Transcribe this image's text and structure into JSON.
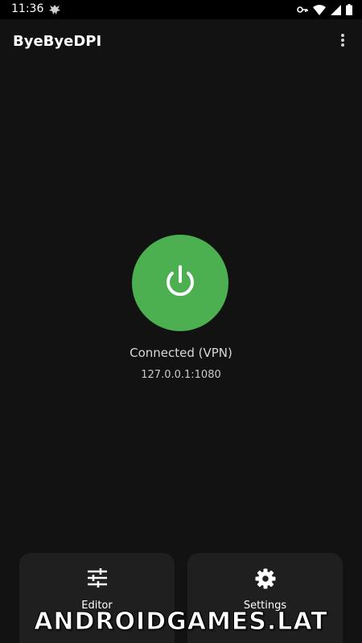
{
  "status_bar": {
    "time": "11:36",
    "icons": [
      "app-notification-icon",
      "vpn-key-icon",
      "wifi-icon",
      "signal-icon",
      "battery-icon"
    ]
  },
  "app_bar": {
    "title": "ByeByeDPI",
    "menu_icon": "more-vert-icon"
  },
  "main": {
    "power_icon": "power-icon",
    "status": "Connected (VPN)",
    "address": "127.0.0.1:1080",
    "accent_color": "#4caf50"
  },
  "bottom_actions": {
    "editor": {
      "label": "Editor",
      "icon": "sliders-icon"
    },
    "settings": {
      "label": "Settings",
      "icon": "gear-icon"
    }
  },
  "watermark": "ANDROIDGAMES.LAT"
}
